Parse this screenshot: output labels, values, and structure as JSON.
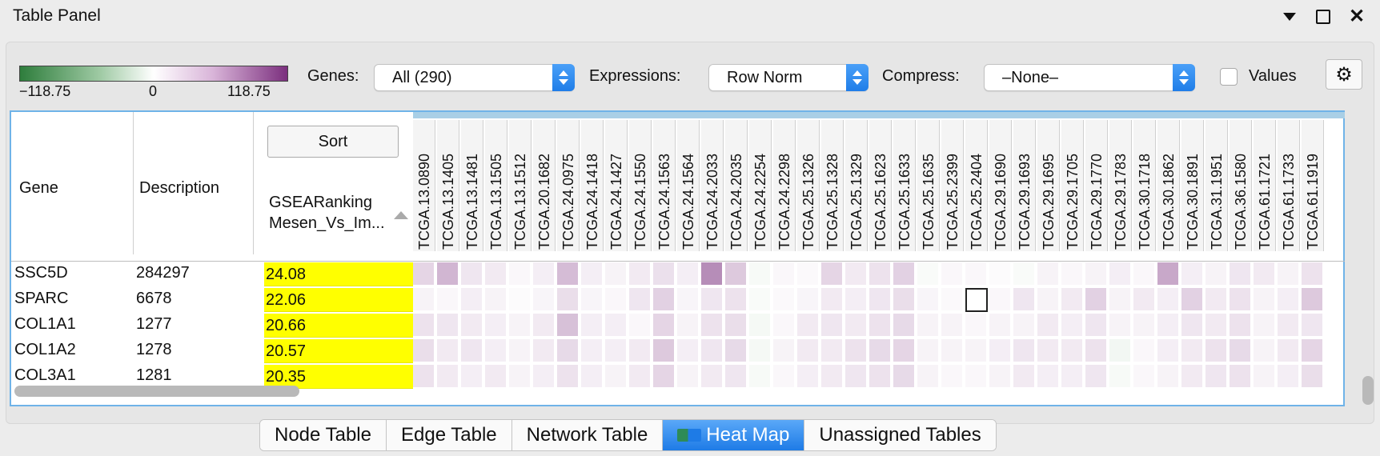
{
  "window": {
    "title": "Table Panel"
  },
  "legend": {
    "min": "−118.75",
    "mid": "0",
    "max": "118.75"
  },
  "toolbar": {
    "genes_label": "Genes:",
    "genes_value": "All (290)",
    "expressions_label": "Expressions:",
    "expressions_value": "Row Norm",
    "compress_label": "Compress:",
    "compress_value": "–None–",
    "values_label": "Values"
  },
  "table": {
    "gene_header": "Gene",
    "description_header": "Description",
    "sort_label": "Sort",
    "rank_header_line1": "GSEARanking",
    "rank_header_line2": "Mesen_Vs_Im...",
    "columns": [
      "TCGA.13.0890",
      "TCGA.13.1405",
      "TCGA.13.1481",
      "TCGA.13.1505",
      "TCGA.13.1512",
      "TCGA.20.1682",
      "TCGA.24.0975",
      "TCGA.24.1418",
      "TCGA.24.1427",
      "TCGA.24.1550",
      "TCGA.24.1563",
      "TCGA.24.1564",
      "TCGA.24.2033",
      "TCGA.24.2035",
      "TCGA.24.2254",
      "TCGA.24.2298",
      "TCGA.25.1326",
      "TCGA.25.1328",
      "TCGA.25.1329",
      "TCGA.25.1623",
      "TCGA.25.1633",
      "TCGA.25.1635",
      "TCGA.25.2399",
      "TCGA.25.2404",
      "TCGA.29.1690",
      "TCGA.29.1693",
      "TCGA.29.1695",
      "TCGA.29.1705",
      "TCGA.29.1770",
      "TCGA.29.1783",
      "TCGA.30.1718",
      "TCGA.30.1862",
      "TCGA.30.1891",
      "TCGA.31.1951",
      "TCGA.36.1580",
      "TCGA.61.1721",
      "TCGA.61.1733",
      "TCGA.61.1919"
    ],
    "rows": [
      {
        "gene": "SSC5D",
        "description": "284297",
        "rank": "24.08"
      },
      {
        "gene": "SPARC",
        "description": "6678",
        "rank": "22.06"
      },
      {
        "gene": "COL1A1",
        "description": "1277",
        "rank": "20.66"
      },
      {
        "gene": "COL1A2",
        "description": "1278",
        "rank": "20.57"
      },
      {
        "gene": "COL3A1",
        "description": "1281",
        "rank": "20.35"
      }
    ],
    "heat": [
      [
        0.2,
        0.35,
        0.12,
        0.1,
        0.04,
        0.08,
        0.32,
        0.08,
        0.06,
        0.1,
        0.15,
        0.08,
        0.55,
        0.26,
        -0.04,
        0.04,
        0.03,
        0.2,
        0.1,
        0.14,
        0.22,
        -0.03,
        0.04,
        0.04,
        0.02,
        -0.03,
        0.06,
        0.04,
        0.06,
        0.08,
        0.04,
        0.42,
        0.08,
        0.06,
        0.12,
        0.1,
        0.06,
        0.14
      ],
      [
        0.06,
        0.04,
        0.08,
        0.06,
        0.02,
        0.05,
        0.16,
        0.05,
        0.04,
        0.12,
        0.22,
        0.05,
        0.12,
        0.14,
        -0.03,
        0.03,
        0.05,
        0.1,
        0.08,
        0.12,
        0.16,
        0.05,
        0.03,
        0.0,
        0.04,
        0.12,
        0.06,
        0.1,
        0.22,
        0.06,
        0.1,
        0.08,
        0.22,
        0.1,
        0.14,
        0.06,
        0.08,
        0.26
      ],
      [
        0.14,
        0.12,
        0.1,
        0.08,
        0.06,
        0.1,
        0.3,
        0.08,
        0.08,
        0.04,
        0.2,
        0.06,
        0.14,
        0.16,
        -0.05,
        0.04,
        0.1,
        0.12,
        0.1,
        0.14,
        0.18,
        0.06,
        0.06,
        0.04,
        0.06,
        0.06,
        0.1,
        0.08,
        0.12,
        0.06,
        0.06,
        0.08,
        0.12,
        0.1,
        0.14,
        0.06,
        0.1,
        0.12
      ],
      [
        0.16,
        0.1,
        0.12,
        0.08,
        0.06,
        0.1,
        0.18,
        0.08,
        0.08,
        0.1,
        0.26,
        0.08,
        0.12,
        0.18,
        -0.05,
        0.06,
        0.1,
        0.1,
        0.14,
        0.18,
        0.2,
        0.06,
        0.06,
        0.06,
        0.08,
        0.12,
        0.1,
        0.1,
        0.14,
        -0.06,
        0.04,
        0.08,
        0.1,
        0.14,
        0.18,
        0.06,
        0.1,
        0.2
      ],
      [
        0.14,
        0.1,
        0.08,
        0.1,
        0.06,
        0.08,
        0.14,
        0.08,
        0.06,
        0.1,
        0.2,
        0.06,
        0.1,
        0.12,
        -0.04,
        0.04,
        0.08,
        0.1,
        0.12,
        0.14,
        0.18,
        0.06,
        0.04,
        0.04,
        0.06,
        0.1,
        0.08,
        0.08,
        0.12,
        -0.04,
        0.04,
        0.06,
        0.1,
        0.12,
        0.14,
        0.06,
        0.08,
        0.16
      ]
    ]
  },
  "tabs": [
    "Node Table",
    "Edge Table",
    "Network Table",
    "Heat Map",
    "Unassigned Tables"
  ],
  "active_tab": "Heat Map",
  "colors": {
    "positive": "#7b2f7e",
    "negative": "#2e7d3c",
    "rank_highlight": "#ffff00",
    "active_tab": "#1e7be6"
  }
}
